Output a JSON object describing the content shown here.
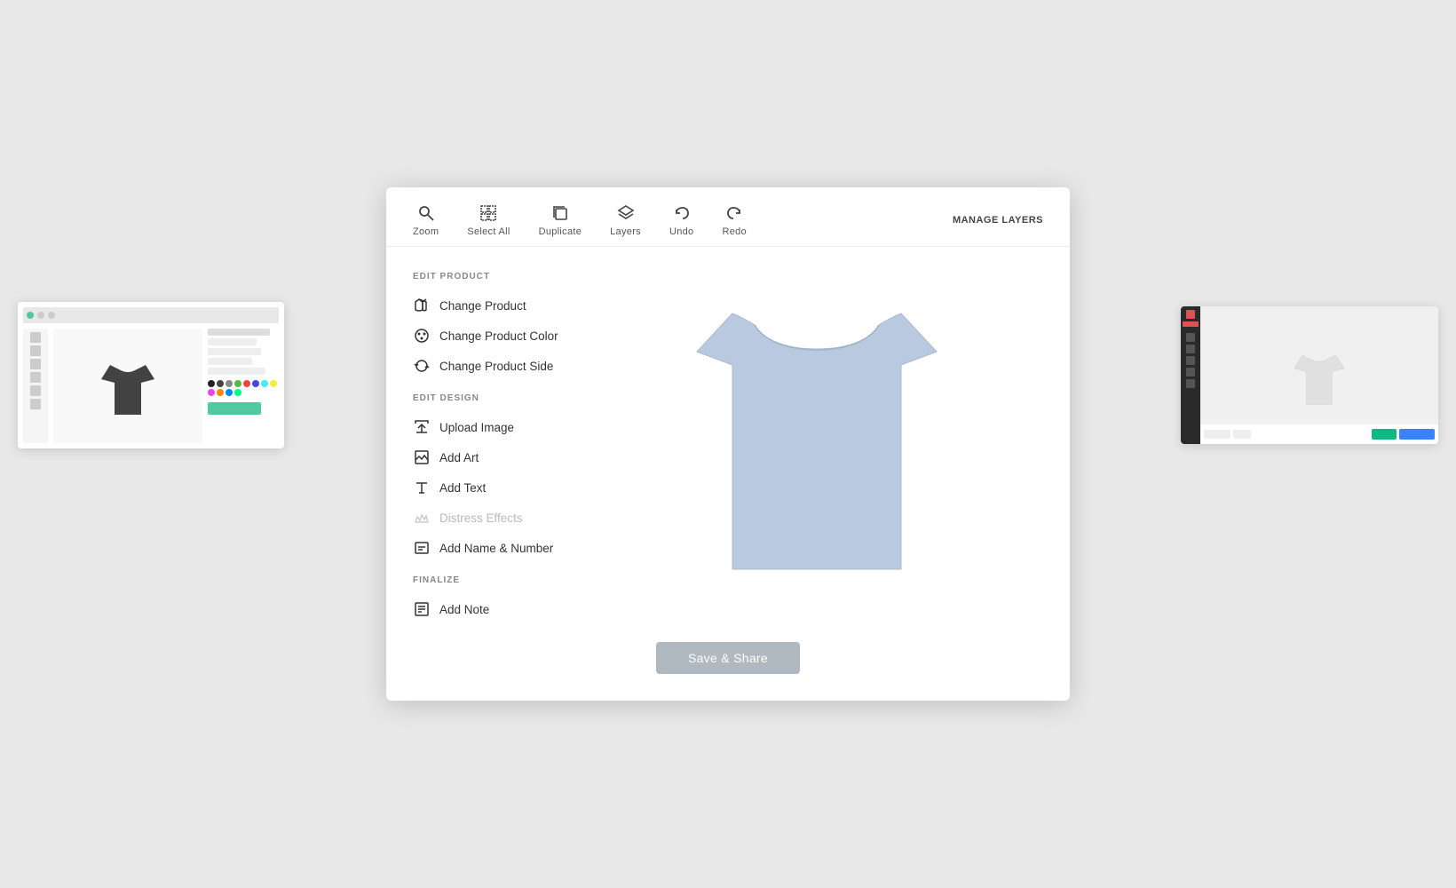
{
  "background_color": "#e8e8e8",
  "toolbar": {
    "items": [
      {
        "id": "zoom",
        "label": "Zoom",
        "icon": "zoom"
      },
      {
        "id": "select_all",
        "label": "Select All",
        "icon": "select_all"
      },
      {
        "id": "duplicate",
        "label": "Duplicate",
        "icon": "duplicate"
      },
      {
        "id": "layers",
        "label": "Layers",
        "icon": "layers"
      },
      {
        "id": "undo",
        "label": "Undo",
        "icon": "undo"
      },
      {
        "id": "redo",
        "label": "Redo",
        "icon": "redo"
      }
    ],
    "manage_layers_label": "MANAGE LAYERS"
  },
  "sidebar": {
    "edit_product_label": "EDIT PRODUCT",
    "edit_design_label": "EDIT DESIGN",
    "finalize_label": "FINALIZE",
    "menu_items": [
      {
        "id": "change_product",
        "label": "Change Product",
        "icon": "tag",
        "disabled": false,
        "section": "edit_product"
      },
      {
        "id": "change_product_color",
        "label": "Change Product Color",
        "icon": "palette",
        "disabled": false,
        "section": "edit_product"
      },
      {
        "id": "change_product_side",
        "label": "Change Product Side",
        "icon": "rotate",
        "disabled": false,
        "section": "edit_product"
      },
      {
        "id": "upload_image",
        "label": "Upload Image",
        "icon": "upload",
        "disabled": false,
        "section": "edit_design"
      },
      {
        "id": "add_art",
        "label": "Add Art",
        "icon": "art",
        "disabled": false,
        "section": "edit_design"
      },
      {
        "id": "add_text",
        "label": "Add Text",
        "icon": "text",
        "disabled": false,
        "section": "edit_design"
      },
      {
        "id": "distress_effects",
        "label": "Distress Effects",
        "icon": "distress",
        "disabled": true,
        "section": "edit_design"
      },
      {
        "id": "add_name_number",
        "label": "Add Name & Number",
        "icon": "number",
        "disabled": false,
        "section": "edit_design"
      },
      {
        "id": "add_note",
        "label": "Add Note",
        "icon": "note",
        "disabled": false,
        "section": "finalize"
      }
    ]
  },
  "canvas": {
    "tshirt_color": "#b8c9e0"
  },
  "save_btn_label": "Save & Share"
}
